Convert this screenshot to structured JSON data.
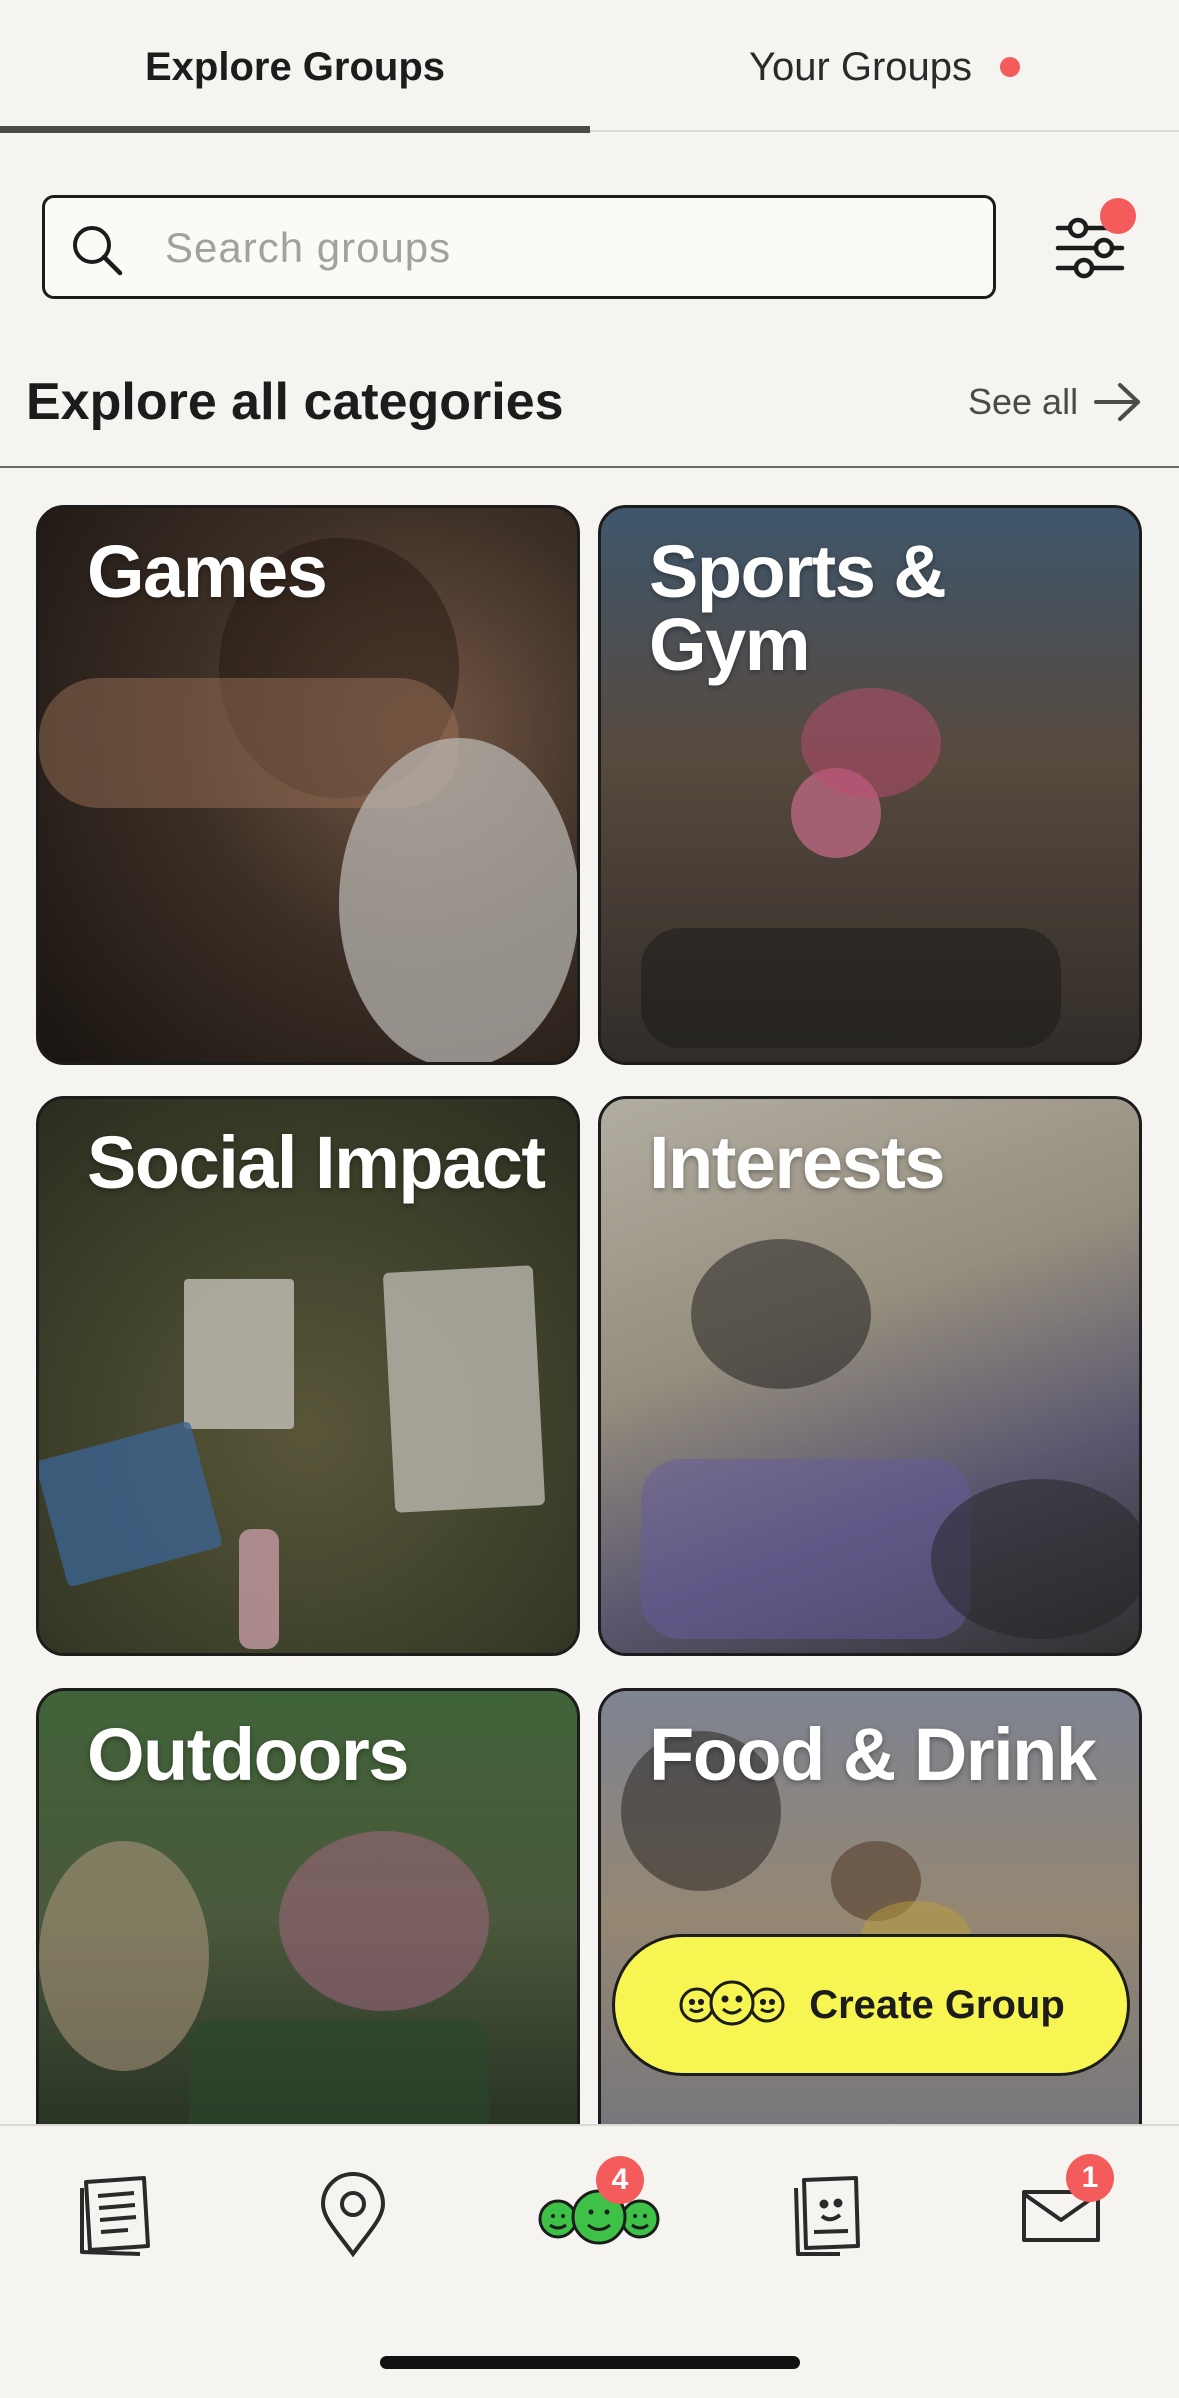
{
  "tabs": {
    "explore": "Explore Groups",
    "yours": "Your Groups"
  },
  "search": {
    "placeholder": "Search groups"
  },
  "section": {
    "title": "Explore all categories",
    "see_all": "See all"
  },
  "categories": [
    {
      "label": "Games"
    },
    {
      "label": "Sports & Gym"
    },
    {
      "label": "Social Impact"
    },
    {
      "label": "Interests"
    },
    {
      "label": "Outdoors"
    },
    {
      "label": "Food & Drink"
    }
  ],
  "create_button": {
    "label": "Create Group"
  },
  "bottom_nav": {
    "groups_badge": "4",
    "inbox_badge": "1"
  },
  "colors": {
    "accent_red": "#f45b5b",
    "create_yellow": "#f7f552",
    "group_green": "#3dc247"
  }
}
